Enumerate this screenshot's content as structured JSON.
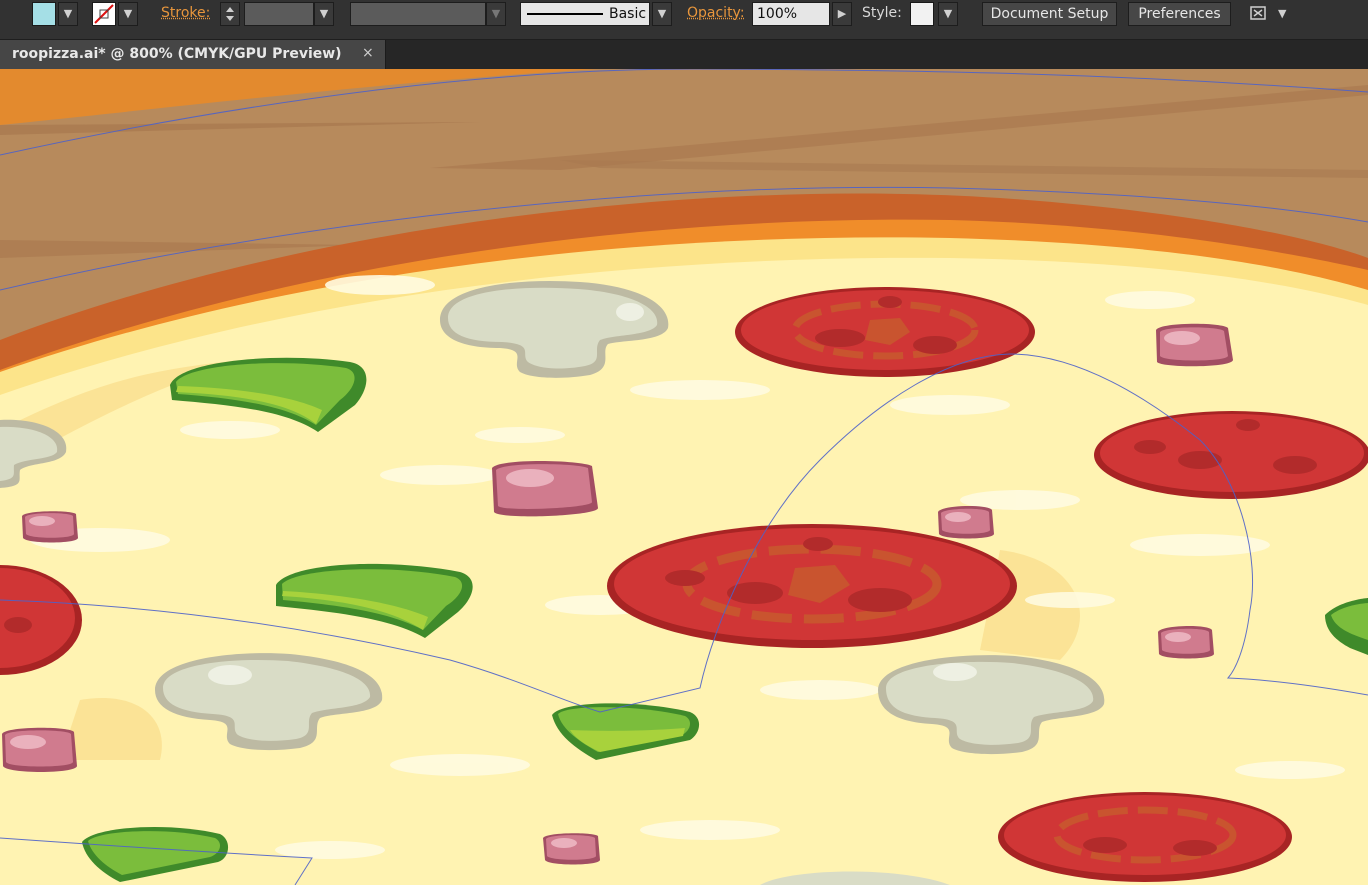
{
  "toolbar": {
    "fill_color": "#a5dfe6",
    "stroke_label": "Stroke:",
    "brush_label": "Basic",
    "opacity_label": "Opacity:",
    "opacity_value": "100%",
    "style_label": "Style:",
    "document_setup_label": "Document Setup",
    "preferences_label": "Preferences",
    "dropdown_glyph": "▼",
    "arrow_right_glyph": "▶"
  },
  "tab": {
    "title": "roopizza.ai* @ 800% (CMYK/GPU Preview)",
    "close": "×"
  },
  "colors": {
    "crust": "#b78a5c",
    "crust_rim": "#f08d2a",
    "cheese": "#fff3b2",
    "pepperoni": "#d03636",
    "pepper": "#7bbd3c",
    "mushroom": "#d9dcc6",
    "ham": "#d07b8e",
    "selection": "#4e62c9"
  }
}
